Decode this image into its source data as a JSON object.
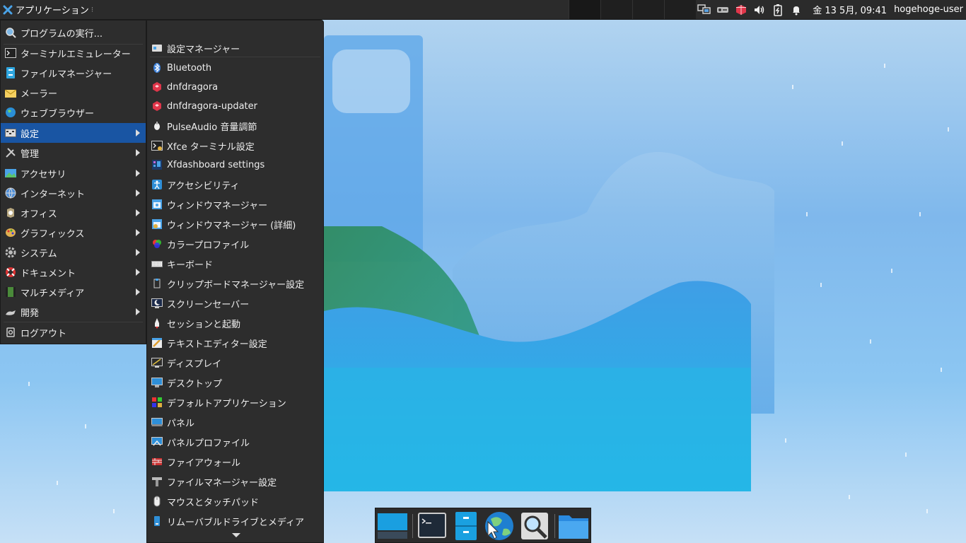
{
  "top_panel": {
    "app_menu_label": "アプリケーション",
    "clock": "金 13  5月, 09:41",
    "user": "hogehoge-user",
    "tray_icons": [
      "network-icon",
      "drive-icon",
      "package-updater-icon",
      "volume-icon",
      "battery-icon",
      "notification-bell-icon"
    ]
  },
  "main_menu": {
    "items": [
      {
        "label": "プログラムの実行...",
        "icon": "run-program-icon",
        "submenu": false
      },
      {
        "label": "ターミナルエミュレーター",
        "icon": "terminal-icon",
        "submenu": false
      },
      {
        "label": "ファイルマネージャー",
        "icon": "file-manager-icon",
        "submenu": false
      },
      {
        "label": "メーラー",
        "icon": "mail-icon",
        "submenu": false
      },
      {
        "label": "ウェブブラウザー",
        "icon": "web-browser-icon",
        "submenu": false
      },
      {
        "label": "設定",
        "icon": "settings-icon",
        "submenu": true,
        "selected": true
      },
      {
        "label": "管理",
        "icon": "admin-tools-icon",
        "submenu": true
      },
      {
        "label": "アクセサリ",
        "icon": "accessories-icon",
        "submenu": true
      },
      {
        "label": "インターネット",
        "icon": "internet-icon",
        "submenu": true
      },
      {
        "label": "オフィス",
        "icon": "office-icon",
        "submenu": true
      },
      {
        "label": "グラフィックス",
        "icon": "graphics-icon",
        "submenu": true
      },
      {
        "label": "システム",
        "icon": "system-gear-icon",
        "submenu": true
      },
      {
        "label": "ドキュメント",
        "icon": "help-lifebuoy-icon",
        "submenu": true
      },
      {
        "label": "マルチメディア",
        "icon": "multimedia-icon",
        "submenu": true
      },
      {
        "label": "開発",
        "icon": "development-icon",
        "submenu": true
      },
      {
        "label": "ログアウト",
        "icon": "logout-icon",
        "submenu": false
      }
    ]
  },
  "settings_menu": {
    "items": [
      {
        "label": "設定マネージャー",
        "icon": "settings-manager-icon"
      },
      {
        "label": "Bluetooth",
        "icon": "bluetooth-icon"
      },
      {
        "label": "dnfdragora",
        "icon": "dnfdragora-icon"
      },
      {
        "label": "dnfdragora-updater",
        "icon": "dnfdragora-updater-icon"
      },
      {
        "label": "PulseAudio 音量調節",
        "icon": "pulseaudio-icon"
      },
      {
        "label": "Xfce ターミナル設定",
        "icon": "terminal-settings-icon"
      },
      {
        "label": "Xfdashboard settings",
        "icon": "xfdashboard-icon"
      },
      {
        "label": "アクセシビリティ",
        "icon": "accessibility-icon"
      },
      {
        "label": "ウィンドウマネージャー",
        "icon": "window-manager-icon"
      },
      {
        "label": "ウィンドウマネージャー (詳細)",
        "icon": "window-manager-tweaks-icon"
      },
      {
        "label": "カラープロファイル",
        "icon": "color-profile-icon"
      },
      {
        "label": "キーボード",
        "icon": "keyboard-icon"
      },
      {
        "label": "クリップボードマネージャー設定",
        "icon": "clipboard-icon"
      },
      {
        "label": "スクリーンセーバー",
        "icon": "screensaver-icon"
      },
      {
        "label": "セッションと起動",
        "icon": "session-startup-icon"
      },
      {
        "label": "テキストエディター設定",
        "icon": "text-editor-icon"
      },
      {
        "label": "ディスプレイ",
        "icon": "display-icon"
      },
      {
        "label": "デスクトップ",
        "icon": "desktop-icon"
      },
      {
        "label": "デフォルトアプリケーション",
        "icon": "default-apps-icon"
      },
      {
        "label": "パネル",
        "icon": "panel-icon"
      },
      {
        "label": "パネルプロファイル",
        "icon": "panel-profile-icon"
      },
      {
        "label": "ファイアウォール",
        "icon": "firewall-icon"
      },
      {
        "label": "ファイルマネージャー設定",
        "icon": "file-manager-settings-icon"
      },
      {
        "label": "マウスとタッチパッド",
        "icon": "mouse-icon"
      },
      {
        "label": "リムーバブルドライブとメディア",
        "icon": "removable-drive-icon"
      }
    ]
  },
  "dock": {
    "items": [
      "show-desktop-icon",
      "terminal-icon",
      "file-manager-icon",
      "web-browser-icon",
      "app-finder-icon",
      "folder-icon"
    ]
  },
  "colors": {
    "panel_bg": "#2b2b2b",
    "menu_bg": "#2d2d2d",
    "selection": "#1955a3"
  }
}
